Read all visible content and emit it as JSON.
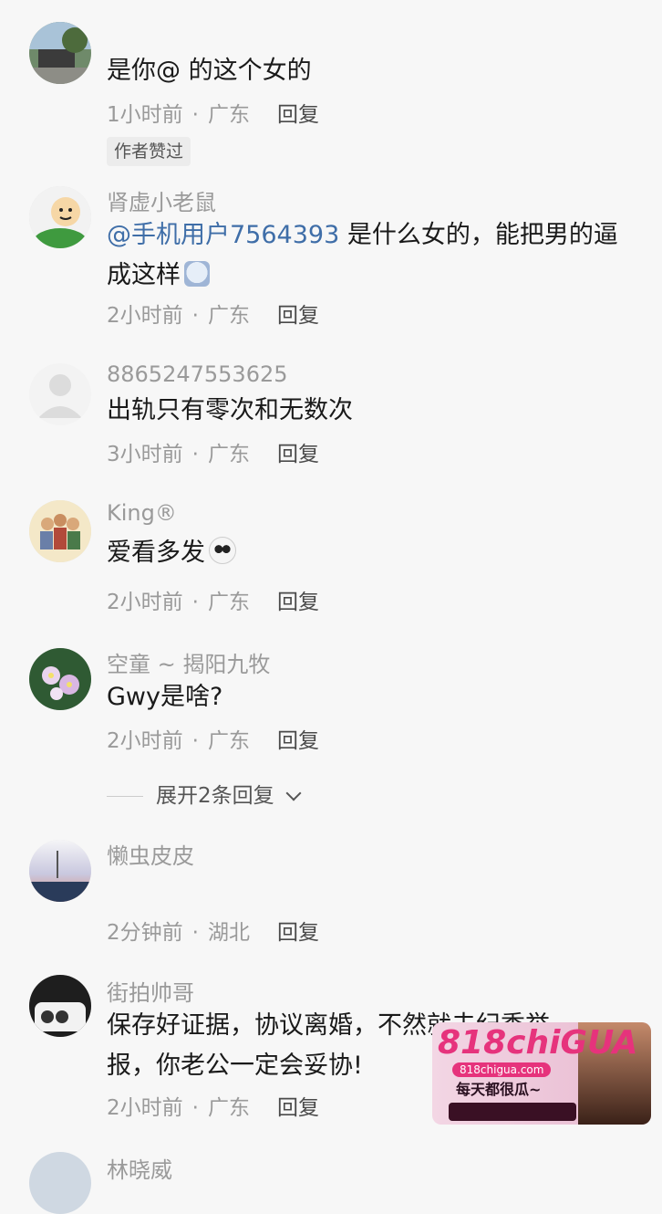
{
  "comments": [
    {
      "username": "",
      "text": "是你@ 的这个女的",
      "time": "1小时前",
      "location": "广东",
      "reply_label": "回复",
      "badge": "作者赞过"
    },
    {
      "username": "肾虚小老鼠",
      "mention": "@手机用户7564393",
      "text": " 是什么女的，能把男的逼成这样",
      "time": "2小时前",
      "location": "广东",
      "reply_label": "回复"
    },
    {
      "username": "8865247553625",
      "text": "出轨只有零次和无数次",
      "time": "3小时前",
      "location": "广东",
      "reply_label": "回复"
    },
    {
      "username": "King®",
      "text": "爱看多发",
      "time": "2小时前",
      "location": "广东",
      "reply_label": "回复"
    },
    {
      "username": "空童 ~ 揭阳九牧",
      "text": "Gwy是啥?",
      "time": "2小时前",
      "location": "广东",
      "reply_label": "回复"
    },
    {
      "username": "懒虫皮皮",
      "text": "",
      "time": "2分钟前",
      "location": "湖北",
      "reply_label": "回复"
    },
    {
      "username": "街拍帅哥",
      "text": "保存好证据，协议离婚，不然就去纪委举报，你老公一定会妥协!",
      "time": "2小时前",
      "location": "广东",
      "reply_label": "回复"
    },
    {
      "username": "林晓威"
    }
  ],
  "expand_replies": "展开2条回复",
  "ad": {
    "logo": "818chiGUA",
    "url": "818chigua.com",
    "slogan": "每天都很瓜~"
  },
  "colors": {
    "mention": "#3f6ea8",
    "meta": "#9a9a9a",
    "ad_accent": "#e6337c"
  }
}
